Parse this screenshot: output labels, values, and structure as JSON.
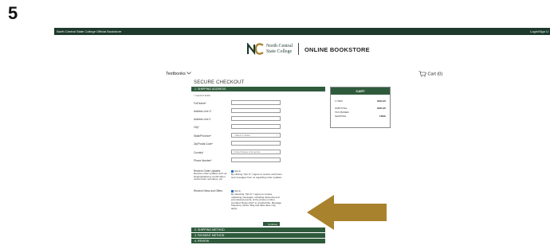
{
  "step_number": "5",
  "topbar": {
    "left_text": "North Central State College Official Bookstore",
    "right_text": "Login/Sign U"
  },
  "logo": {
    "name_line1": "North Central",
    "name_line2": "State College",
    "store_label": "ONLINE BOOKSTORE",
    "brand_color": "#1d3a2c"
  },
  "nav": {
    "textbooks": "Textbooks",
    "cart": "Cart (0)"
  },
  "checkout": {
    "title": "SECURE CHECKOUT",
    "required_note": "* required fields",
    "sections": [
      {
        "label": "1. SHIPPING ADDRESS"
      },
      {
        "label": "2. SHIPPING METHOD"
      },
      {
        "label": "3. PAYMENT METHOD"
      },
      {
        "label": "4. REVIEW"
      }
    ],
    "fields": [
      {
        "label": "Full Name*",
        "value": ""
      },
      {
        "label": "Address Line 1*",
        "value": ""
      },
      {
        "label": "Address Line 2",
        "value": ""
      },
      {
        "label": "City*",
        "value": ""
      },
      {
        "label": "State/Province*",
        "value": "- Select a State -"
      },
      {
        "label": "Zip/Postal Code*",
        "value": ""
      },
      {
        "label": "Country*",
        "value": "United States of America"
      },
      {
        "label": "Phone Number*",
        "value": ""
      }
    ],
    "order_updates": {
      "label": "Receive Order Updates",
      "label_desc": "Receive order updates such as shipping/delivery confirmation, rental return reminders, etc.",
      "checkbox": "Opt In",
      "desc": "By clicking \"Opt In\" I agree to receive cell phone text messages from us regarding order updates."
    },
    "news_offers": {
      "label": "Receive News and Offers",
      "checkbox": "Opt In",
      "desc": "By selecting \"Opt In\" I agree to receive marketing messages, including discounts and promotional events, at the phone number provided. Reply QUIT to unsubscribe. Message frequency varies. Msg and data rates may apply."
    },
    "continue_label": "Continue"
  },
  "cart": {
    "title": "CART",
    "rows": [
      {
        "label": "1 ITEM",
        "value": "$363.95"
      },
      {
        "label": "SUBTOTAL",
        "value": "$363.95"
      },
      {
        "label": "TAX (BASED",
        "value": ""
      },
      {
        "label": "SHIPPING",
        "value": "FREE"
      }
    ]
  },
  "colors": {
    "header_green": "#2f5b3c",
    "topbar": "#1d3a2c",
    "arrow": "#a8822c"
  }
}
